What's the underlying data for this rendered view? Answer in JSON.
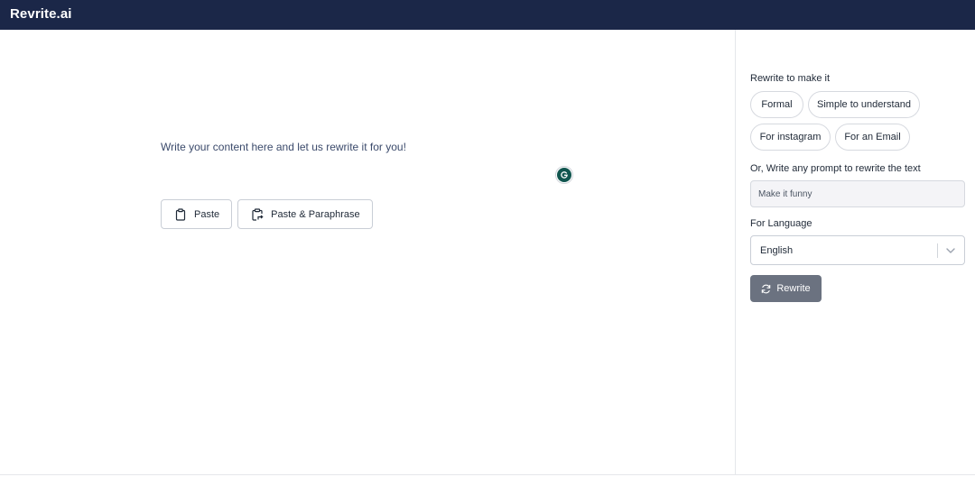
{
  "header": {
    "brand": "Revrite.ai"
  },
  "editor": {
    "placeholder": "Write your content here and let us rewrite it for you!",
    "paste_label": "Paste",
    "paste_paraphrase_label": "Paste & Paraphrase",
    "grammarly_icon": "grammarly-g-icon"
  },
  "sidebar": {
    "rewrite_heading": "Rewrite to make it",
    "chips": [
      "Formal",
      "Simple to understand",
      "For instagram",
      "For an Email"
    ],
    "prompt_heading": "Or, Write any prompt to rewrite the text",
    "prompt_placeholder": "Make it funny",
    "language_heading": "For Language",
    "language_value": "English",
    "rewrite_button": "Rewrite"
  },
  "colors": {
    "topbar": "#1b2748",
    "rewrite_button": "#6b7280",
    "grammarly": "#11564f"
  }
}
